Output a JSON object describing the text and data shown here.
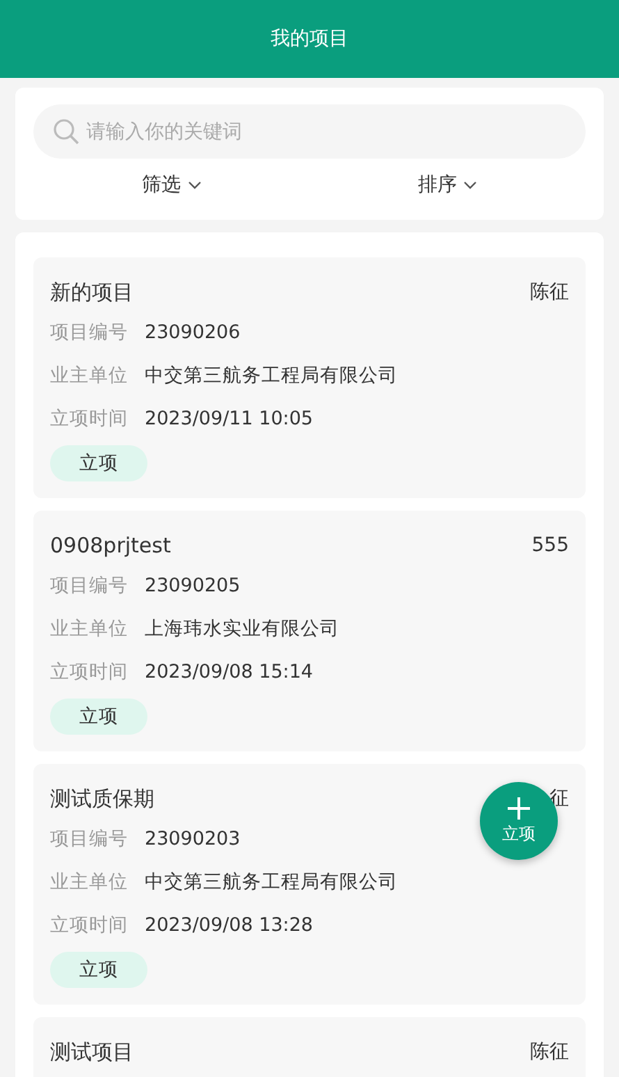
{
  "header": {
    "title": "我的项目"
  },
  "search": {
    "placeholder": "请输入你的关键词"
  },
  "toolbar": [
    {
      "label": "筛选"
    },
    {
      "label": "排序"
    }
  ],
  "projects": [
    {
      "title": "新的项目",
      "owner": "陈征",
      "fields": [
        {
          "label": "项目编号",
          "value": "23090206"
        },
        {
          "label": "业主单位",
          "value": "中交第三航务工程局有限公司"
        },
        {
          "label": "立项时间",
          "value": "2023/09/11 10:05"
        }
      ],
      "status": "立项"
    },
    {
      "title": "0908prjtest",
      "owner": "555",
      "fields": [
        {
          "label": "项目编号",
          "value": "23090205"
        },
        {
          "label": "业主单位",
          "value": "上海玮水实业有限公司"
        },
        {
          "label": "立项时间",
          "value": "2023/09/08 15:14"
        }
      ],
      "status": "立项"
    },
    {
      "title": "测试质保期",
      "owner": "征",
      "fields": [
        {
          "label": "项目编号",
          "value": "23090203"
        },
        {
          "label": "业主单位",
          "value": "中交第三航务工程局有限公司"
        },
        {
          "label": "立项时间",
          "value": "2023/09/08 13:28"
        }
      ],
      "status": "立项"
    },
    {
      "title": "测试项目",
      "owner": "陈征"
    }
  ],
  "fab": {
    "label": "立项"
  }
}
